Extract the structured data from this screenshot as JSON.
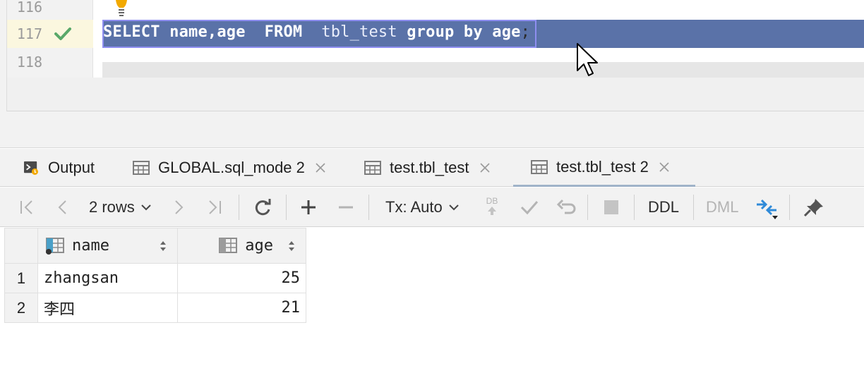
{
  "editor": {
    "lines": [
      {
        "number": "116"
      },
      {
        "number": "117"
      },
      {
        "number": "118"
      }
    ],
    "query": {
      "kw_select": "SELECT",
      "part_name_age": "name,age",
      "kw_from": "FROM",
      "table": "tbl_test",
      "kw_group_by": "group by",
      "group_col": "age",
      "terminator": ";"
    },
    "icons": {
      "run_status": "check-icon",
      "intention": "lightbulb-icon"
    },
    "colors": {
      "selection": "#5a72a8",
      "check": "#59a869",
      "bulb": "#f2a900"
    }
  },
  "tabs": [
    {
      "label": "Output",
      "icon": "console-icon"
    },
    {
      "label": "GLOBAL.sql_mode 2",
      "icon": "table-icon"
    },
    {
      "label": "test.tbl_test",
      "icon": "table-icon"
    },
    {
      "label": "test.tbl_test 2",
      "icon": "table-icon",
      "active": true
    }
  ],
  "toolbar": {
    "rows_label": "2 rows",
    "tx_label": "Tx: Auto",
    "db_label": "DB",
    "ddl_label": "DDL",
    "dml_label": "DML"
  },
  "grid": {
    "columns": [
      {
        "label": "name"
      },
      {
        "label": "age"
      }
    ],
    "rows": [
      {
        "num": "1",
        "name": "zhangsan",
        "age": "25"
      },
      {
        "num": "2",
        "name": "李四",
        "age": "21"
      }
    ]
  }
}
